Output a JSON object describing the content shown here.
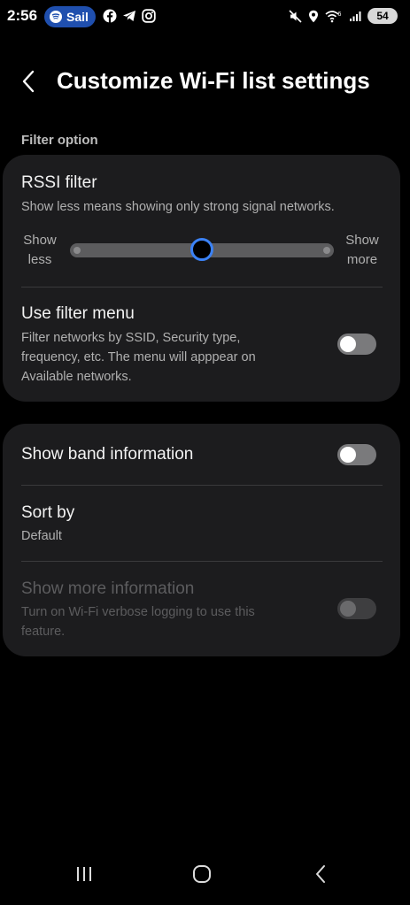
{
  "status_bar": {
    "time": "2:56",
    "media_pill": {
      "icon": "spotify-icon",
      "label": "Sail",
      "color": "#1f4fae"
    },
    "app_icons": [
      "facebook-icon",
      "telegram-icon",
      "instagram-icon"
    ],
    "system_icons": [
      "mute-icon",
      "location-icon",
      "wifi-6-icon",
      "signal-icon"
    ],
    "wifi_badge": "6",
    "battery": "54"
  },
  "header": {
    "title": "Customize Wi-Fi list settings"
  },
  "section": {
    "label": "Filter option"
  },
  "filter_card": {
    "rssi": {
      "title": "RSSI filter",
      "subtitle": "Show less means showing only strong signal networks.",
      "left_label_1": "Show",
      "left_label_2": "less",
      "right_label_1": "Show",
      "right_label_2": "more",
      "level_fraction": 0.5,
      "accent": "#3b82f6"
    },
    "filter_menu": {
      "title": "Use filter menu",
      "subtitle_1": "Filter networks by SSID, Security type,",
      "subtitle_2": "frequency, etc. The menu will apppear on",
      "subtitle_3": "Available networks.",
      "enabled": false
    }
  },
  "display_card": {
    "band_info": {
      "title": "Show band information",
      "enabled": false
    },
    "sort_by": {
      "title": "Sort by",
      "value": "Default"
    },
    "more_info": {
      "title": "Show more information",
      "subtitle_1": "Turn on Wi-Fi verbose logging to use this",
      "subtitle_2": "feature.",
      "enabled": false,
      "disabled": true
    }
  },
  "nav_bar": {
    "buttons": [
      "recents-icon",
      "home-icon",
      "back-nav-icon"
    ]
  }
}
